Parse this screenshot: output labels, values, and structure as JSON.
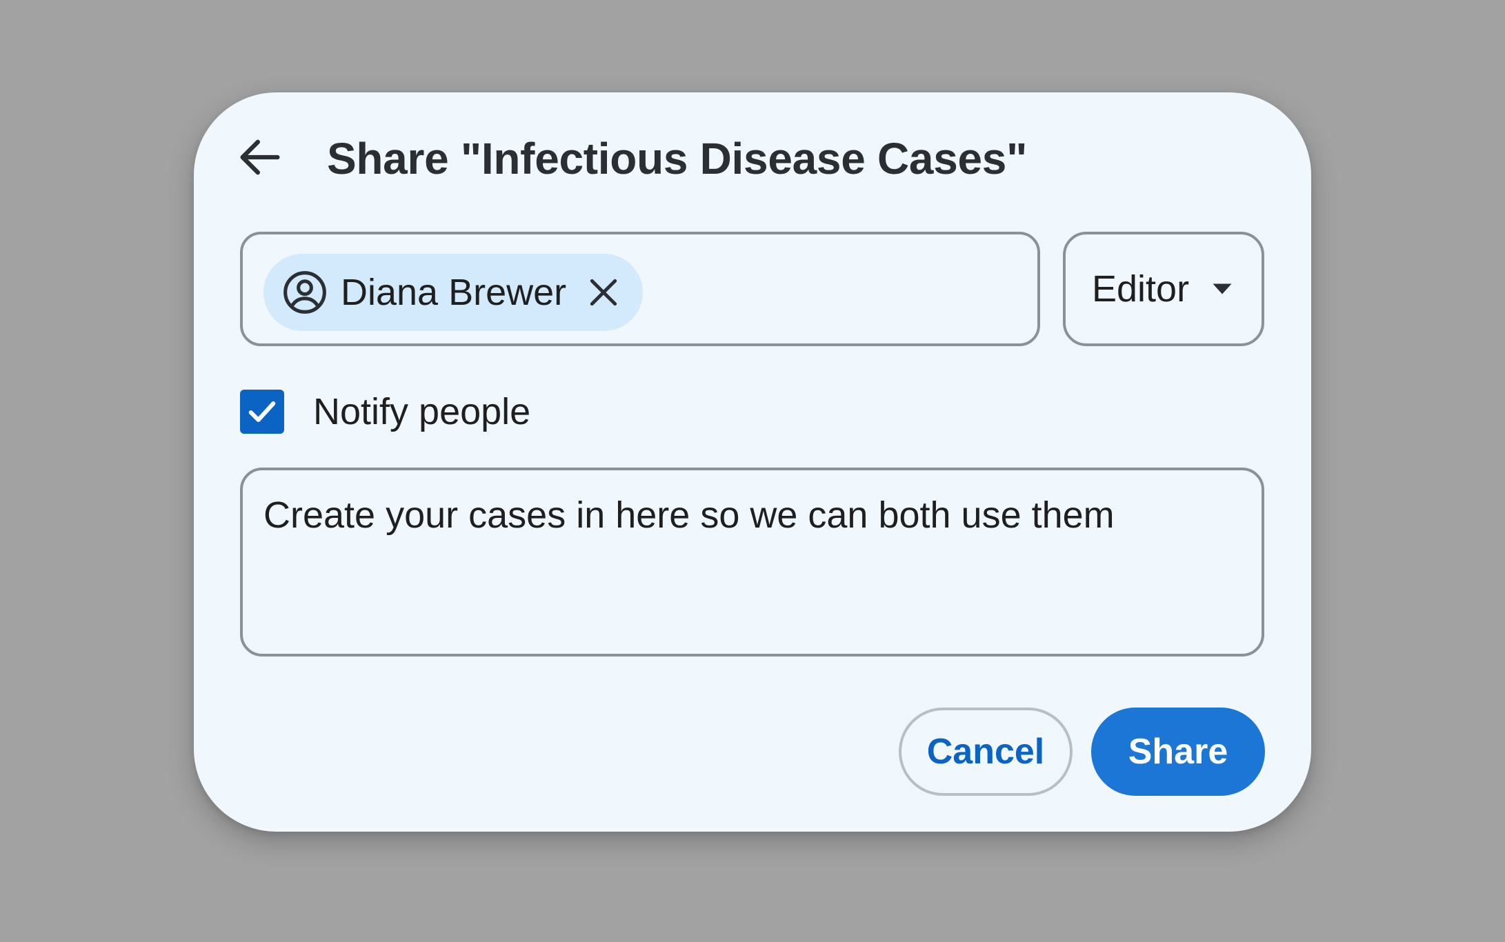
{
  "dialog": {
    "title": "Share \"Infectious Disease Cases\"",
    "back_icon": "arrow-left-icon"
  },
  "recipients": {
    "chips": [
      {
        "name": "Diana Brewer",
        "icon": "account-circle-icon",
        "remove_icon": "close-icon"
      }
    ]
  },
  "role": {
    "selected": "Editor",
    "icon": "caret-down-icon"
  },
  "notify": {
    "label": "Notify people",
    "checked": true
  },
  "message": {
    "value": "Create your cases in here so we can both use them"
  },
  "actions": {
    "cancel_label": "Cancel",
    "share_label": "Share"
  },
  "colors": {
    "backdrop": "#a2a2a2",
    "dialog_bg": "#f0f7fd",
    "chip_bg": "#d3eafd",
    "primary": "#1b76d6",
    "checkbox": "#0b63c4",
    "border": "#8b9196"
  }
}
